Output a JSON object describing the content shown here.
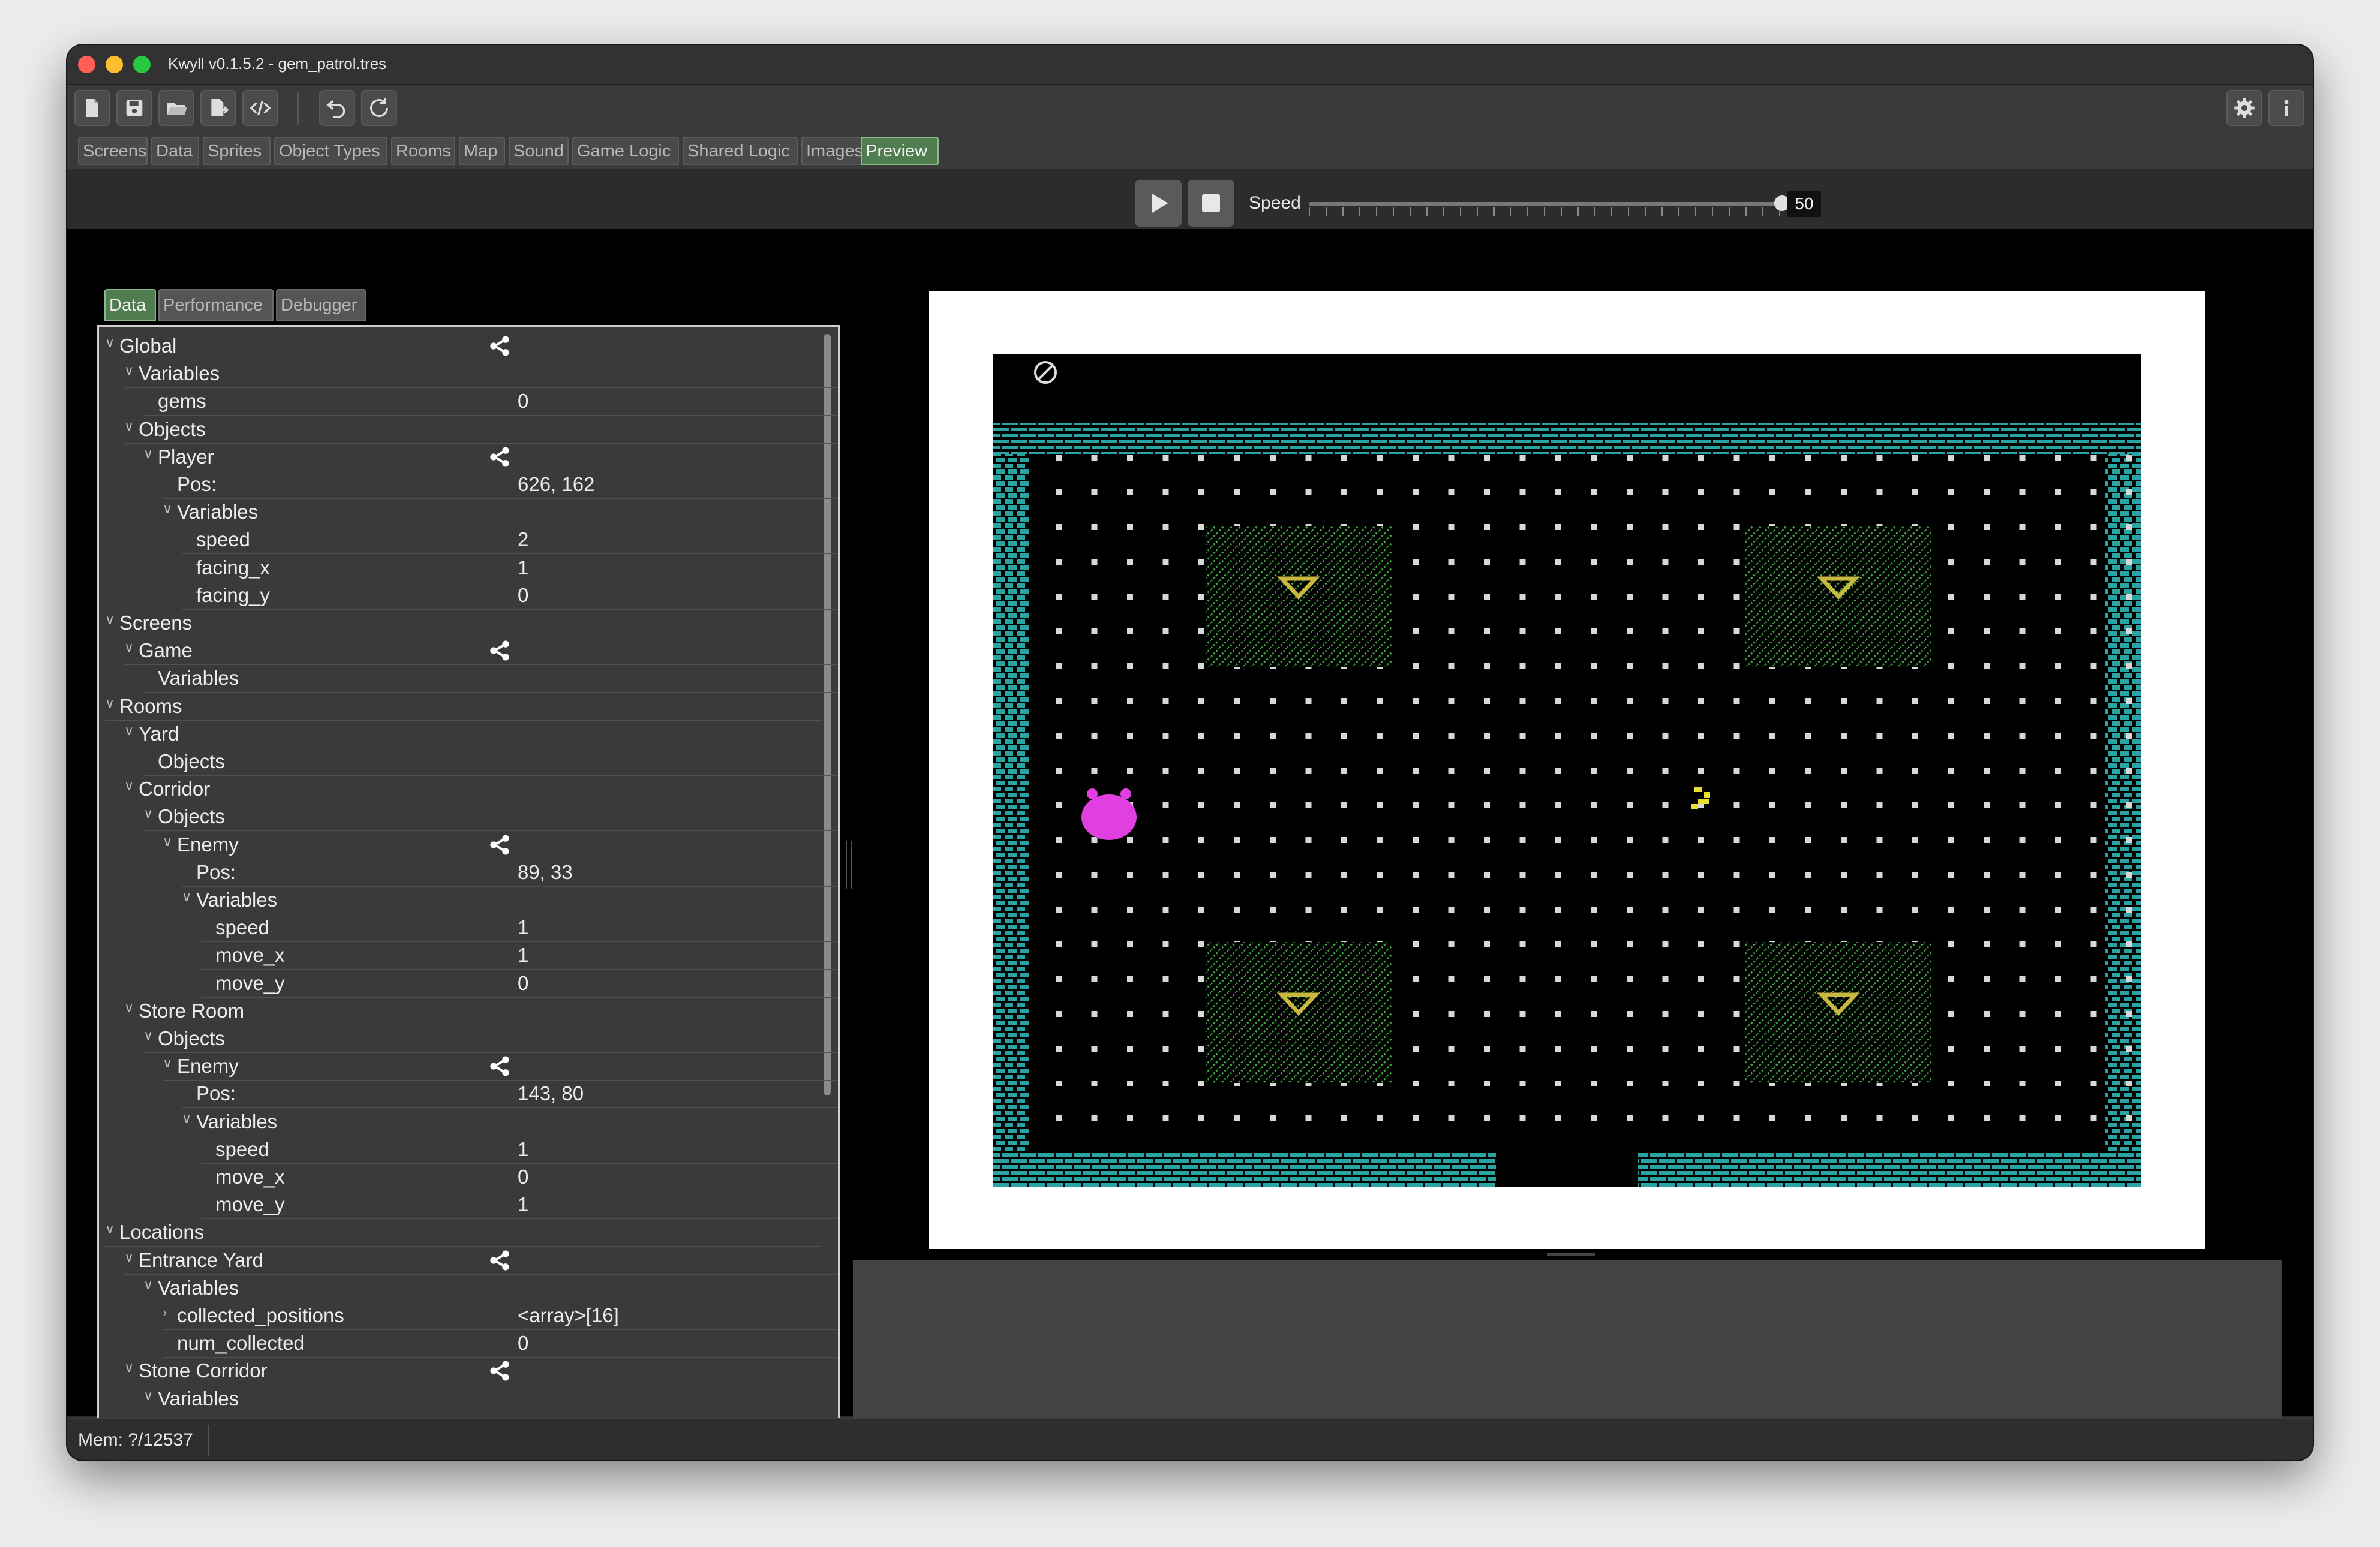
{
  "window": {
    "title": "Kwyll v0.1.5.2 - gem_patrol.tres"
  },
  "toolbar": {
    "buttons": [
      "new-file-icon",
      "save-icon",
      "open-folder-icon",
      "export-icon",
      "code-icon",
      "undo-icon",
      "redo-icon"
    ],
    "right_buttons": [
      "gear-icon",
      "info-icon"
    ]
  },
  "tabs": [
    "Screens",
    "Data",
    "Sprites",
    "Object Types",
    "Rooms",
    "Map",
    "Sound",
    "Game Logic",
    "Shared Logic",
    "Images",
    "Preview"
  ],
  "active_tab": "Preview",
  "playback": {
    "speed_label": "Speed",
    "speed_value": "50",
    "speed_min": 0,
    "speed_max": 50
  },
  "panel_tabs": [
    "Data",
    "Performance",
    "Debugger"
  ],
  "active_panel_tab": "Data",
  "tree": [
    {
      "label": "Global",
      "depth": 0,
      "expanded": true,
      "share": true
    },
    {
      "label": "Variables",
      "depth": 1,
      "expanded": true
    },
    {
      "label": "gems",
      "depth": 2,
      "value": "0"
    },
    {
      "label": "Objects",
      "depth": 1,
      "expanded": true
    },
    {
      "label": "Player",
      "depth": 2,
      "expanded": true,
      "share": true
    },
    {
      "label": "Pos:",
      "depth": 3,
      "value": "626, 162"
    },
    {
      "label": "Variables",
      "depth": 3,
      "expanded": true
    },
    {
      "label": "speed",
      "depth": 4,
      "value": "2"
    },
    {
      "label": "facing_x",
      "depth": 4,
      "value": "1"
    },
    {
      "label": "facing_y",
      "depth": 4,
      "value": "0"
    },
    {
      "label": "Screens",
      "depth": 0,
      "expanded": true
    },
    {
      "label": "Game",
      "depth": 1,
      "expanded": true,
      "share": true
    },
    {
      "label": "Variables",
      "depth": 2
    },
    {
      "label": "Rooms",
      "depth": 0,
      "expanded": true
    },
    {
      "label": "Yard",
      "depth": 1,
      "expanded": true
    },
    {
      "label": "Objects",
      "depth": 2
    },
    {
      "label": "Corridor",
      "depth": 1,
      "expanded": true
    },
    {
      "label": "Objects",
      "depth": 2,
      "expanded": true
    },
    {
      "label": "Enemy",
      "depth": 3,
      "expanded": true,
      "share": true
    },
    {
      "label": "Pos:",
      "depth": 4,
      "value": "89, 33"
    },
    {
      "label": "Variables",
      "depth": 4,
      "expanded": true
    },
    {
      "label": "speed",
      "depth": 5,
      "value": "1"
    },
    {
      "label": "move_x",
      "depth": 5,
      "value": "1"
    },
    {
      "label": "move_y",
      "depth": 5,
      "value": "0"
    },
    {
      "label": "Store Room",
      "depth": 1,
      "expanded": true
    },
    {
      "label": "Objects",
      "depth": 2,
      "expanded": true
    },
    {
      "label": "Enemy",
      "depth": 3,
      "expanded": true,
      "share": true
    },
    {
      "label": "Pos:",
      "depth": 4,
      "value": "143, 80"
    },
    {
      "label": "Variables",
      "depth": 4,
      "expanded": true
    },
    {
      "label": "speed",
      "depth": 5,
      "value": "1"
    },
    {
      "label": "move_x",
      "depth": 5,
      "value": "0"
    },
    {
      "label": "move_y",
      "depth": 5,
      "value": "1"
    },
    {
      "label": "Locations",
      "depth": 0,
      "expanded": true
    },
    {
      "label": "Entrance Yard",
      "depth": 1,
      "expanded": true,
      "share": true
    },
    {
      "label": "Variables",
      "depth": 2,
      "expanded": true
    },
    {
      "label": "collected_positions",
      "depth": 3,
      "collapsed": true,
      "value": "<array>[16]"
    },
    {
      "label": "num_collected",
      "depth": 3,
      "value": "0"
    },
    {
      "label": "Stone Corridor",
      "depth": 1,
      "expanded": true,
      "share": true
    },
    {
      "label": "Variables",
      "depth": 2,
      "expanded": true
    }
  ],
  "game": {
    "colors": {
      "wall": "#2aa3a3",
      "dot": "#d8d8d8",
      "grass": "#3fa33f",
      "gem": "#c8b840",
      "player": "#e040e0",
      "sparkle": "#e8e030"
    }
  },
  "status": {
    "mem": "Mem: ?/12537"
  }
}
